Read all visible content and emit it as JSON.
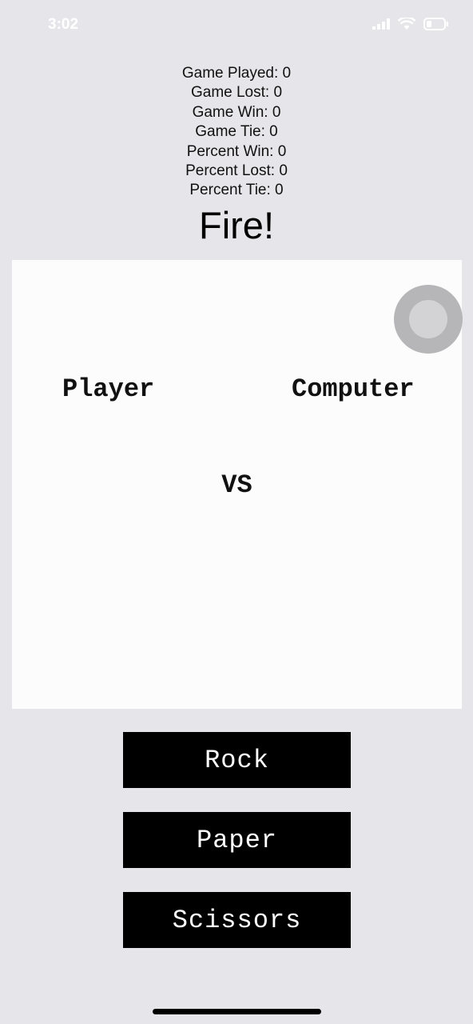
{
  "status_bar": {
    "time": "3:02",
    "signal_icon": "cellular-signal-icon",
    "wifi_icon": "wifi-icon",
    "battery_icon": "battery-icon"
  },
  "stats": {
    "played": "Game Played: 0",
    "lost": "Game Lost: 0",
    "win": "Game Win: 0",
    "tie": "Game Tie: 0",
    "percent_win": "Percent Win: 0",
    "percent_lost": "Percent Lost: 0",
    "percent_tie": "Percent Tie: 0"
  },
  "title": "Fire!",
  "arena": {
    "player_label": "Player",
    "computer_label": "Computer",
    "vs_label": "VS"
  },
  "buttons": {
    "rock": "Rock",
    "paper": "Paper",
    "scissors": "Scissors"
  },
  "colors": {
    "background": "#e6e6ea",
    "arena": "#fdfcfd",
    "button_bg": "#000000",
    "button_text": "#ffffff"
  }
}
